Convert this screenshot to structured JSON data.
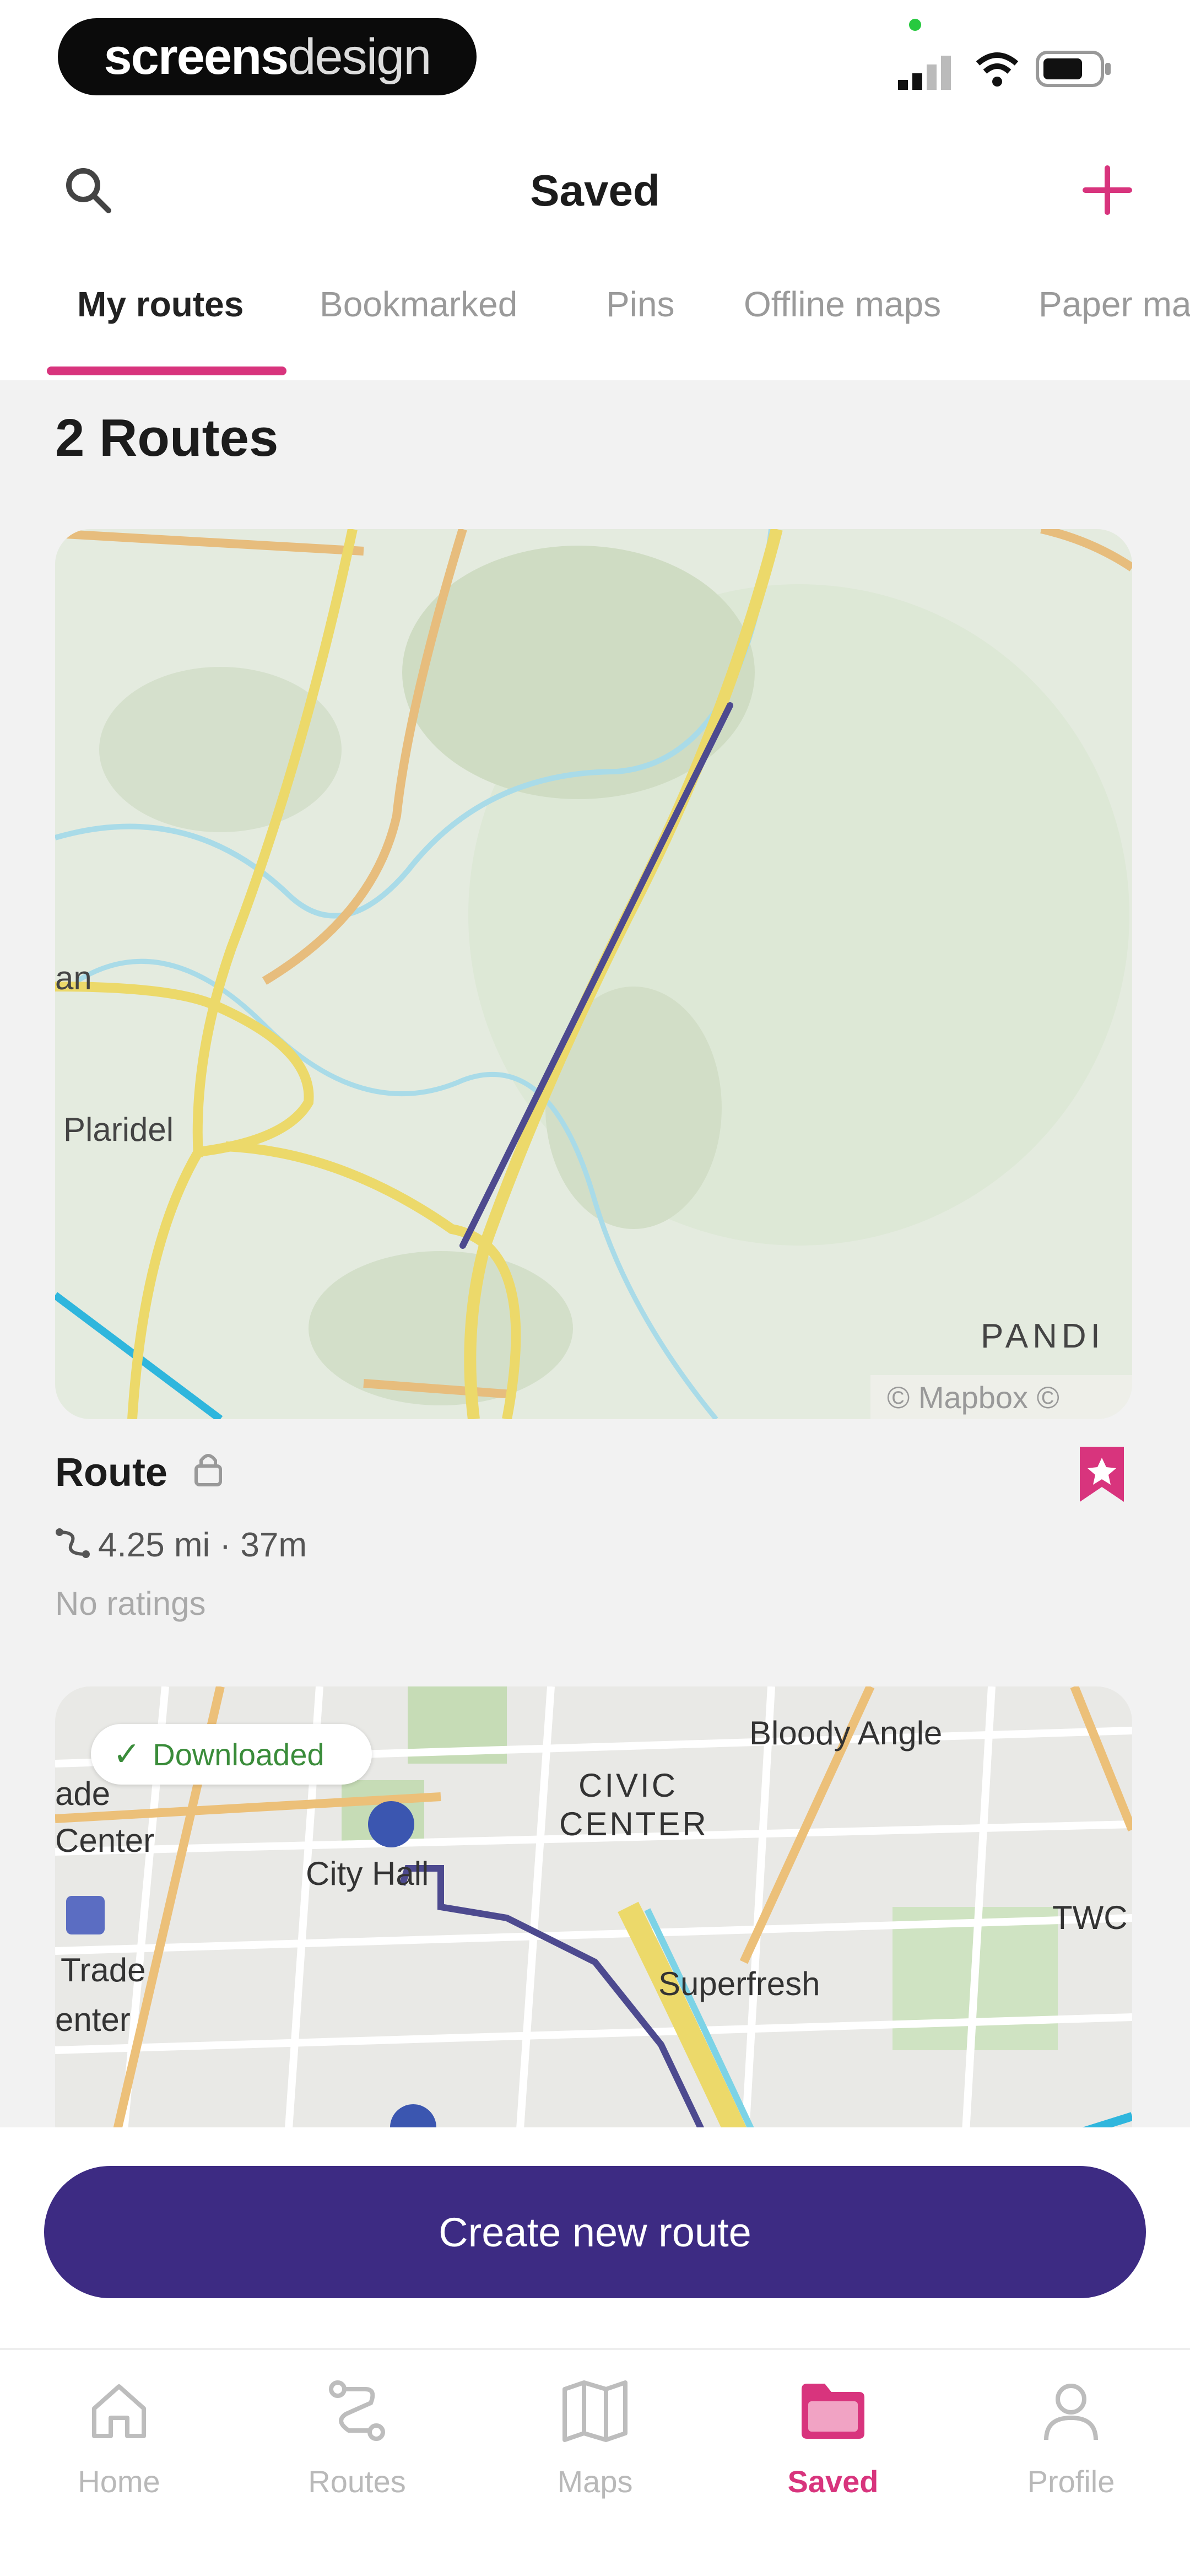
{
  "status_bar": {
    "logo_bold": "screens",
    "logo_light": "design",
    "accent_dot_color": "#27c93f"
  },
  "header": {
    "title": "Saved",
    "search_icon": "search-icon",
    "add_icon": "plus-icon",
    "accent_color": "#d8347d"
  },
  "tabs": [
    {
      "label": "My routes",
      "active": true
    },
    {
      "label": "Bookmarked",
      "active": false
    },
    {
      "label": "Pins",
      "active": false
    },
    {
      "label": "Offline maps",
      "active": false
    },
    {
      "label": "Paper ma",
      "active": false
    }
  ],
  "content": {
    "count_label": "2 Routes",
    "cards": [
      {
        "map_labels": [
          "an",
          "Plaridel",
          "PANDI",
          "© Mapbox © "
        ],
        "title": "Route",
        "lock_icon": "lock-icon",
        "bookmark_icon": "bookmark-icon",
        "meta": "4.25 mi · 37m",
        "ratings": "No ratings"
      },
      {
        "badge": "Downloaded",
        "map_labels": [
          "Bloody Angle",
          "CIVIC",
          "CENTER",
          "City Hall",
          "Superfresh",
          "TWC",
          "Center",
          "Trade",
          "enter",
          "ade"
        ]
      }
    ]
  },
  "cta": {
    "label": "Create new route",
    "color": "#3d2b83"
  },
  "nav": [
    {
      "label": "Home",
      "icon": "home-icon",
      "active": false
    },
    {
      "label": "Routes",
      "icon": "route-icon",
      "active": false
    },
    {
      "label": "Maps",
      "icon": "map-icon",
      "active": false
    },
    {
      "label": "Saved",
      "icon": "folder-icon",
      "active": true
    },
    {
      "label": "Profile",
      "icon": "profile-icon",
      "active": false
    }
  ]
}
